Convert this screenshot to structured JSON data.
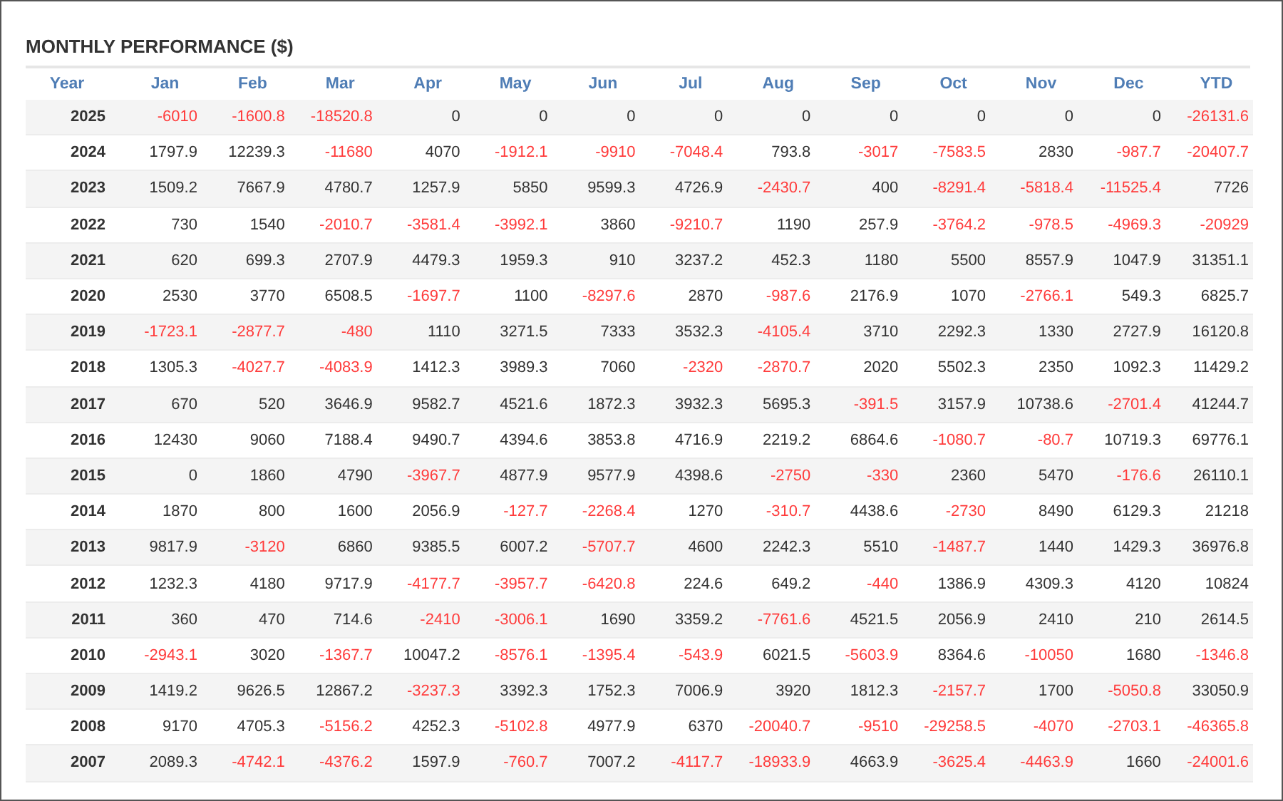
{
  "title": "MONTHLY PERFORMANCE ($)",
  "columns": [
    "Year",
    "Jan",
    "Feb",
    "Mar",
    "Apr",
    "May",
    "Jun",
    "Jul",
    "Aug",
    "Sep",
    "Oct",
    "Nov",
    "Dec",
    "YTD"
  ],
  "rows": [
    {
      "year": "2025",
      "cells": [
        "-6010",
        "-1600.8",
        "-18520.8",
        "0",
        "0",
        "0",
        "0",
        "0",
        "0",
        "0",
        "0",
        "0",
        "-26131.6"
      ],
      "negative": [
        true,
        true,
        true,
        false,
        false,
        false,
        false,
        false,
        false,
        false,
        false,
        false,
        true
      ]
    },
    {
      "year": "2024",
      "cells": [
        "1797.9",
        "12239.3",
        "-11680",
        "4070",
        "-1912.1",
        "-9910",
        "-7048.4",
        "793.8",
        "-3017",
        "-7583.5",
        "2830",
        "-987.7",
        "-20407.7"
      ],
      "negative": [
        false,
        false,
        true,
        false,
        true,
        true,
        true,
        false,
        true,
        true,
        false,
        true,
        true
      ]
    },
    {
      "year": "2023",
      "cells": [
        "1509.2",
        "7667.9",
        "4780.7",
        "1257.9",
        "5850",
        "9599.3",
        "4726.9",
        "-2430.7",
        "400",
        "-8291.4",
        "-5818.4",
        "-11525.4",
        "7726"
      ],
      "negative": [
        false,
        false,
        false,
        false,
        false,
        false,
        false,
        true,
        false,
        true,
        true,
        true,
        false
      ]
    },
    {
      "year": "2022",
      "cells": [
        "730",
        "1540",
        "-2010.7",
        "-3581.4",
        "-3992.1",
        "3860",
        "-9210.7",
        "1190",
        "257.9",
        "-3764.2",
        "-978.5",
        "-4969.3",
        "-20929"
      ],
      "negative": [
        false,
        false,
        true,
        true,
        true,
        false,
        true,
        false,
        false,
        true,
        true,
        true,
        true
      ]
    },
    {
      "year": "2021",
      "cells": [
        "620",
        "699.3",
        "2707.9",
        "4479.3",
        "1959.3",
        "910",
        "3237.2",
        "452.3",
        "1180",
        "5500",
        "8557.9",
        "1047.9",
        "31351.1"
      ],
      "negative": [
        false,
        false,
        false,
        false,
        false,
        false,
        false,
        false,
        false,
        false,
        false,
        false,
        false
      ]
    },
    {
      "year": "2020",
      "cells": [
        "2530",
        "3770",
        "6508.5",
        "-1697.7",
        "1100",
        "-8297.6",
        "2870",
        "-987.6",
        "2176.9",
        "1070",
        "-2766.1",
        "549.3",
        "6825.7"
      ],
      "negative": [
        false,
        false,
        false,
        true,
        false,
        true,
        false,
        true,
        false,
        false,
        true,
        false,
        false
      ]
    },
    {
      "year": "2019",
      "cells": [
        "-1723.1",
        "-2877.7",
        "-480",
        "1110",
        "3271.5",
        "7333",
        "3532.3",
        "-4105.4",
        "3710",
        "2292.3",
        "1330",
        "2727.9",
        "16120.8"
      ],
      "negative": [
        true,
        true,
        true,
        false,
        false,
        false,
        false,
        true,
        false,
        false,
        false,
        false,
        false
      ]
    },
    {
      "year": "2018",
      "cells": [
        "1305.3",
        "-4027.7",
        "-4083.9",
        "1412.3",
        "3989.3",
        "7060",
        "-2320",
        "-2870.7",
        "2020",
        "5502.3",
        "2350",
        "1092.3",
        "11429.2"
      ],
      "negative": [
        false,
        true,
        true,
        false,
        false,
        false,
        true,
        true,
        false,
        false,
        false,
        false,
        false
      ]
    },
    {
      "year": "2017",
      "cells": [
        "670",
        "520",
        "3646.9",
        "9582.7",
        "4521.6",
        "1872.3",
        "3932.3",
        "5695.3",
        "-391.5",
        "3157.9",
        "10738.6",
        "-2701.4",
        "41244.7"
      ],
      "negative": [
        false,
        false,
        false,
        false,
        false,
        false,
        false,
        false,
        true,
        false,
        false,
        true,
        false
      ]
    },
    {
      "year": "2016",
      "cells": [
        "12430",
        "9060",
        "7188.4",
        "9490.7",
        "4394.6",
        "3853.8",
        "4716.9",
        "2219.2",
        "6864.6",
        "-1080.7",
        "-80.7",
        "10719.3",
        "69776.1"
      ],
      "negative": [
        false,
        false,
        false,
        false,
        false,
        false,
        false,
        false,
        false,
        true,
        true,
        false,
        false
      ]
    },
    {
      "year": "2015",
      "cells": [
        "0",
        "1860",
        "4790",
        "-3967.7",
        "4877.9",
        "9577.9",
        "4398.6",
        "-2750",
        "-330",
        "2360",
        "5470",
        "-176.6",
        "26110.1"
      ],
      "negative": [
        false,
        false,
        false,
        true,
        false,
        false,
        false,
        true,
        true,
        false,
        false,
        true,
        false
      ]
    },
    {
      "year": "2014",
      "cells": [
        "1870",
        "800",
        "1600",
        "2056.9",
        "-127.7",
        "-2268.4",
        "1270",
        "-310.7",
        "4438.6",
        "-2730",
        "8490",
        "6129.3",
        "21218"
      ],
      "negative": [
        false,
        false,
        false,
        false,
        true,
        true,
        false,
        true,
        false,
        true,
        false,
        false,
        false
      ]
    },
    {
      "year": "2013",
      "cells": [
        "9817.9",
        "-3120",
        "6860",
        "9385.5",
        "6007.2",
        "-5707.7",
        "4600",
        "2242.3",
        "5510",
        "-1487.7",
        "1440",
        "1429.3",
        "36976.8"
      ],
      "negative": [
        false,
        true,
        false,
        false,
        false,
        true,
        false,
        false,
        false,
        true,
        false,
        false,
        false
      ]
    },
    {
      "year": "2012",
      "cells": [
        "1232.3",
        "4180",
        "9717.9",
        "-4177.7",
        "-3957.7",
        "-6420.8",
        "224.6",
        "649.2",
        "-440",
        "1386.9",
        "4309.3",
        "4120",
        "10824"
      ],
      "negative": [
        false,
        false,
        false,
        true,
        true,
        true,
        false,
        false,
        true,
        false,
        false,
        false,
        false
      ]
    },
    {
      "year": "2011",
      "cells": [
        "360",
        "470",
        "714.6",
        "-2410",
        "-3006.1",
        "1690",
        "3359.2",
        "-7761.6",
        "4521.5",
        "2056.9",
        "2410",
        "210",
        "2614.5"
      ],
      "negative": [
        false,
        false,
        false,
        true,
        true,
        false,
        false,
        true,
        false,
        false,
        false,
        false,
        false
      ]
    },
    {
      "year": "2010",
      "cells": [
        "-2943.1",
        "3020",
        "-1367.7",
        "10047.2",
        "-8576.1",
        "-1395.4",
        "-543.9",
        "6021.5",
        "-5603.9",
        "8364.6",
        "-10050",
        "1680",
        "-1346.8"
      ],
      "negative": [
        true,
        false,
        true,
        false,
        true,
        true,
        true,
        false,
        true,
        false,
        true,
        false,
        true
      ]
    },
    {
      "year": "2009",
      "cells": [
        "1419.2",
        "9626.5",
        "12867.2",
        "-3237.3",
        "3392.3",
        "1752.3",
        "7006.9",
        "3920",
        "1812.3",
        "-2157.7",
        "1700",
        "-5050.8",
        "33050.9"
      ],
      "negative": [
        false,
        false,
        false,
        true,
        false,
        false,
        false,
        false,
        false,
        true,
        false,
        true,
        false
      ]
    },
    {
      "year": "2008",
      "cells": [
        "9170",
        "4705.3",
        "-5156.2",
        "4252.3",
        "-5102.8",
        "4977.9",
        "6370",
        "-20040.7",
        "-9510",
        "-29258.5",
        "-4070",
        "-2703.1",
        "-46365.8"
      ],
      "negative": [
        false,
        false,
        true,
        false,
        true,
        false,
        false,
        true,
        true,
        true,
        true,
        true,
        true
      ]
    },
    {
      "year": "2007",
      "cells": [
        "2089.3",
        "-4742.1",
        "-4376.2",
        "1597.9",
        "-760.7",
        "7007.2",
        "-4117.7",
        "-18933.9",
        "4663.9",
        "-3625.4",
        "-4463.9",
        "1660",
        "-24001.6"
      ],
      "negative": [
        false,
        true,
        true,
        false,
        true,
        false,
        true,
        true,
        false,
        true,
        true,
        false,
        true
      ]
    }
  ]
}
